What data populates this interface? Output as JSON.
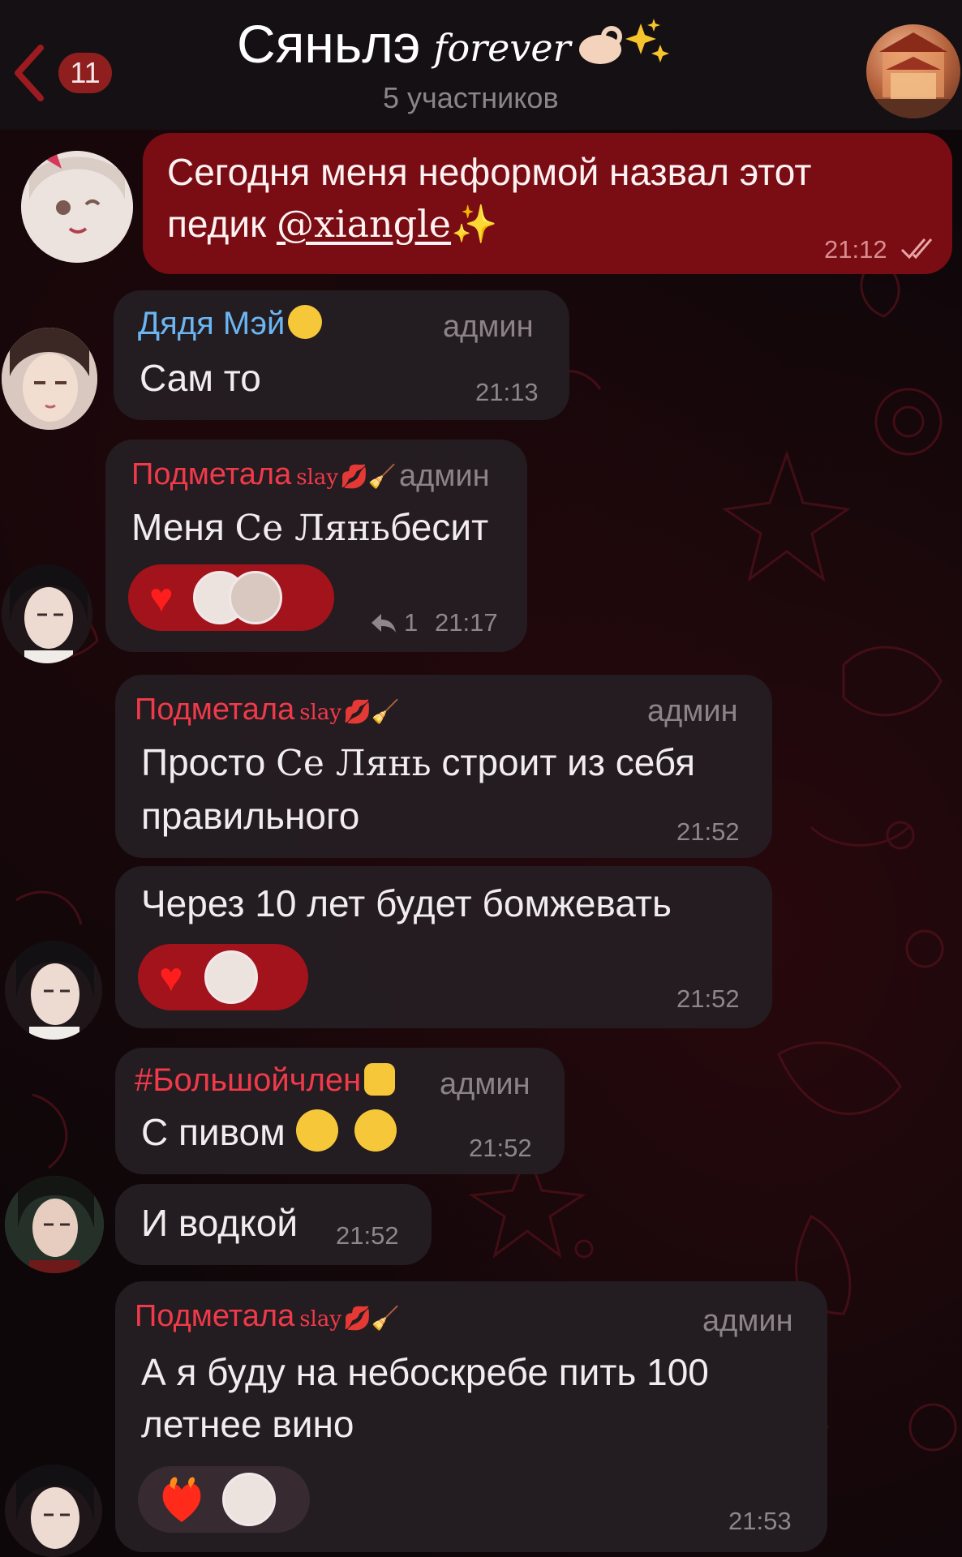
{
  "header": {
    "back_label": "back",
    "unread_count": "11",
    "title": "Сяньлэ",
    "title_script": "forever",
    "subtitle": "5 участников"
  },
  "messages": [
    {
      "type": "outgoing",
      "text_line1": "Сегодня меня неформой назвал этот",
      "text_line2_prefix": "педик ",
      "mention": "@xiangle",
      "time": "21:12"
    },
    {
      "sender": "Дядя Мэй",
      "sender_color": "#6bb6f2",
      "role": "админ",
      "text": "Сам то",
      "time": "21:13"
    },
    {
      "sender": "Подметала",
      "sender_suffix": "slay",
      "sender_color": "#f03a4a",
      "role": "админ",
      "text_prefix": "Меня ",
      "text_name": "Се Лянь",
      "text_suffix": "бесит",
      "reaction": "heart",
      "reply_count": "1",
      "time": "21:17"
    },
    {
      "sender": "Подметала",
      "sender_suffix": "slay",
      "sender_color": "#f03a4a",
      "role": "админ",
      "text_prefix": "Просто ",
      "text_name": "Се Лянь",
      "text_suffix": " строит из себя",
      "text_line2": "правильного",
      "time": "21:52"
    },
    {
      "text": "Через 10 лет будет бомжевать",
      "reaction": "heart",
      "time": "21:52"
    },
    {
      "sender": "#Большойчлен",
      "sender_color": "#f03a4a",
      "role": "админ",
      "text": "С пивом",
      "time": "21:52"
    },
    {
      "text": "И водкой",
      "time": "21:52"
    },
    {
      "sender": "Подметала",
      "sender_suffix": "slay",
      "sender_color": "#f03a4a",
      "role": "админ",
      "text_line1": "А я буду на небоскребе пить 100",
      "text_line2": "летнее вино",
      "reaction": "heart-on-fire",
      "time": "21:53"
    }
  ],
  "colors": {
    "accent_red": "#a3131b",
    "outgoing_bubble": "#7a0d14",
    "incoming_bubble": "#241d21"
  }
}
